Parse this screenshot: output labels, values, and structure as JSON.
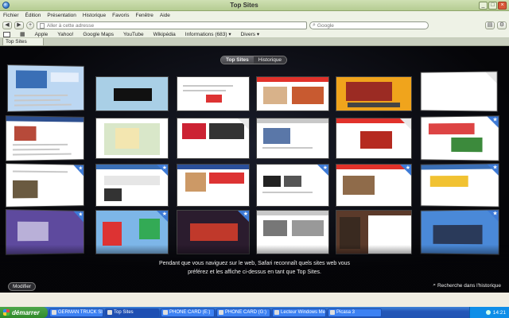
{
  "window": {
    "title": "Top Sites",
    "buttons": [
      "_",
      "□",
      "×"
    ]
  },
  "menu": [
    "Fichier",
    "Édition",
    "Présentation",
    "Historique",
    "Favoris",
    "Fenêtre",
    "Aide"
  ],
  "toolbar": {
    "back": "◀",
    "forward": "▶",
    "add": "+",
    "address_placeholder": "Aller à cette adresse",
    "search_placeholder": "Google"
  },
  "bookmarks": [
    "Apple",
    "Yahoo!",
    "Google Maps",
    "YouTube",
    "Wikipédia",
    "Informations (683) ▾",
    "Divers ▾"
  ],
  "tab": {
    "label": "Top Sites"
  },
  "topsites": {
    "tabs": [
      "Top Sites",
      "Historique"
    ],
    "info_line1": "Pendant que vous naviguez sur le web, Safari reconnaît quels sites web vous",
    "info_line2": "préférez et les affiche ci-dessus en tant que Top Sites.",
    "edit_label": "Modifier",
    "search_label": "Recherche dans l'historique"
  },
  "taskbar": {
    "start": "démarrer",
    "tasks": [
      "GERMAN TRUCK SIM...",
      "Top Sites",
      "PHONE CARD (E:)",
      "PHONE CARD (G:)",
      "Lecteur Windows Media",
      "Picasa 3"
    ],
    "clock": "14:21"
  }
}
